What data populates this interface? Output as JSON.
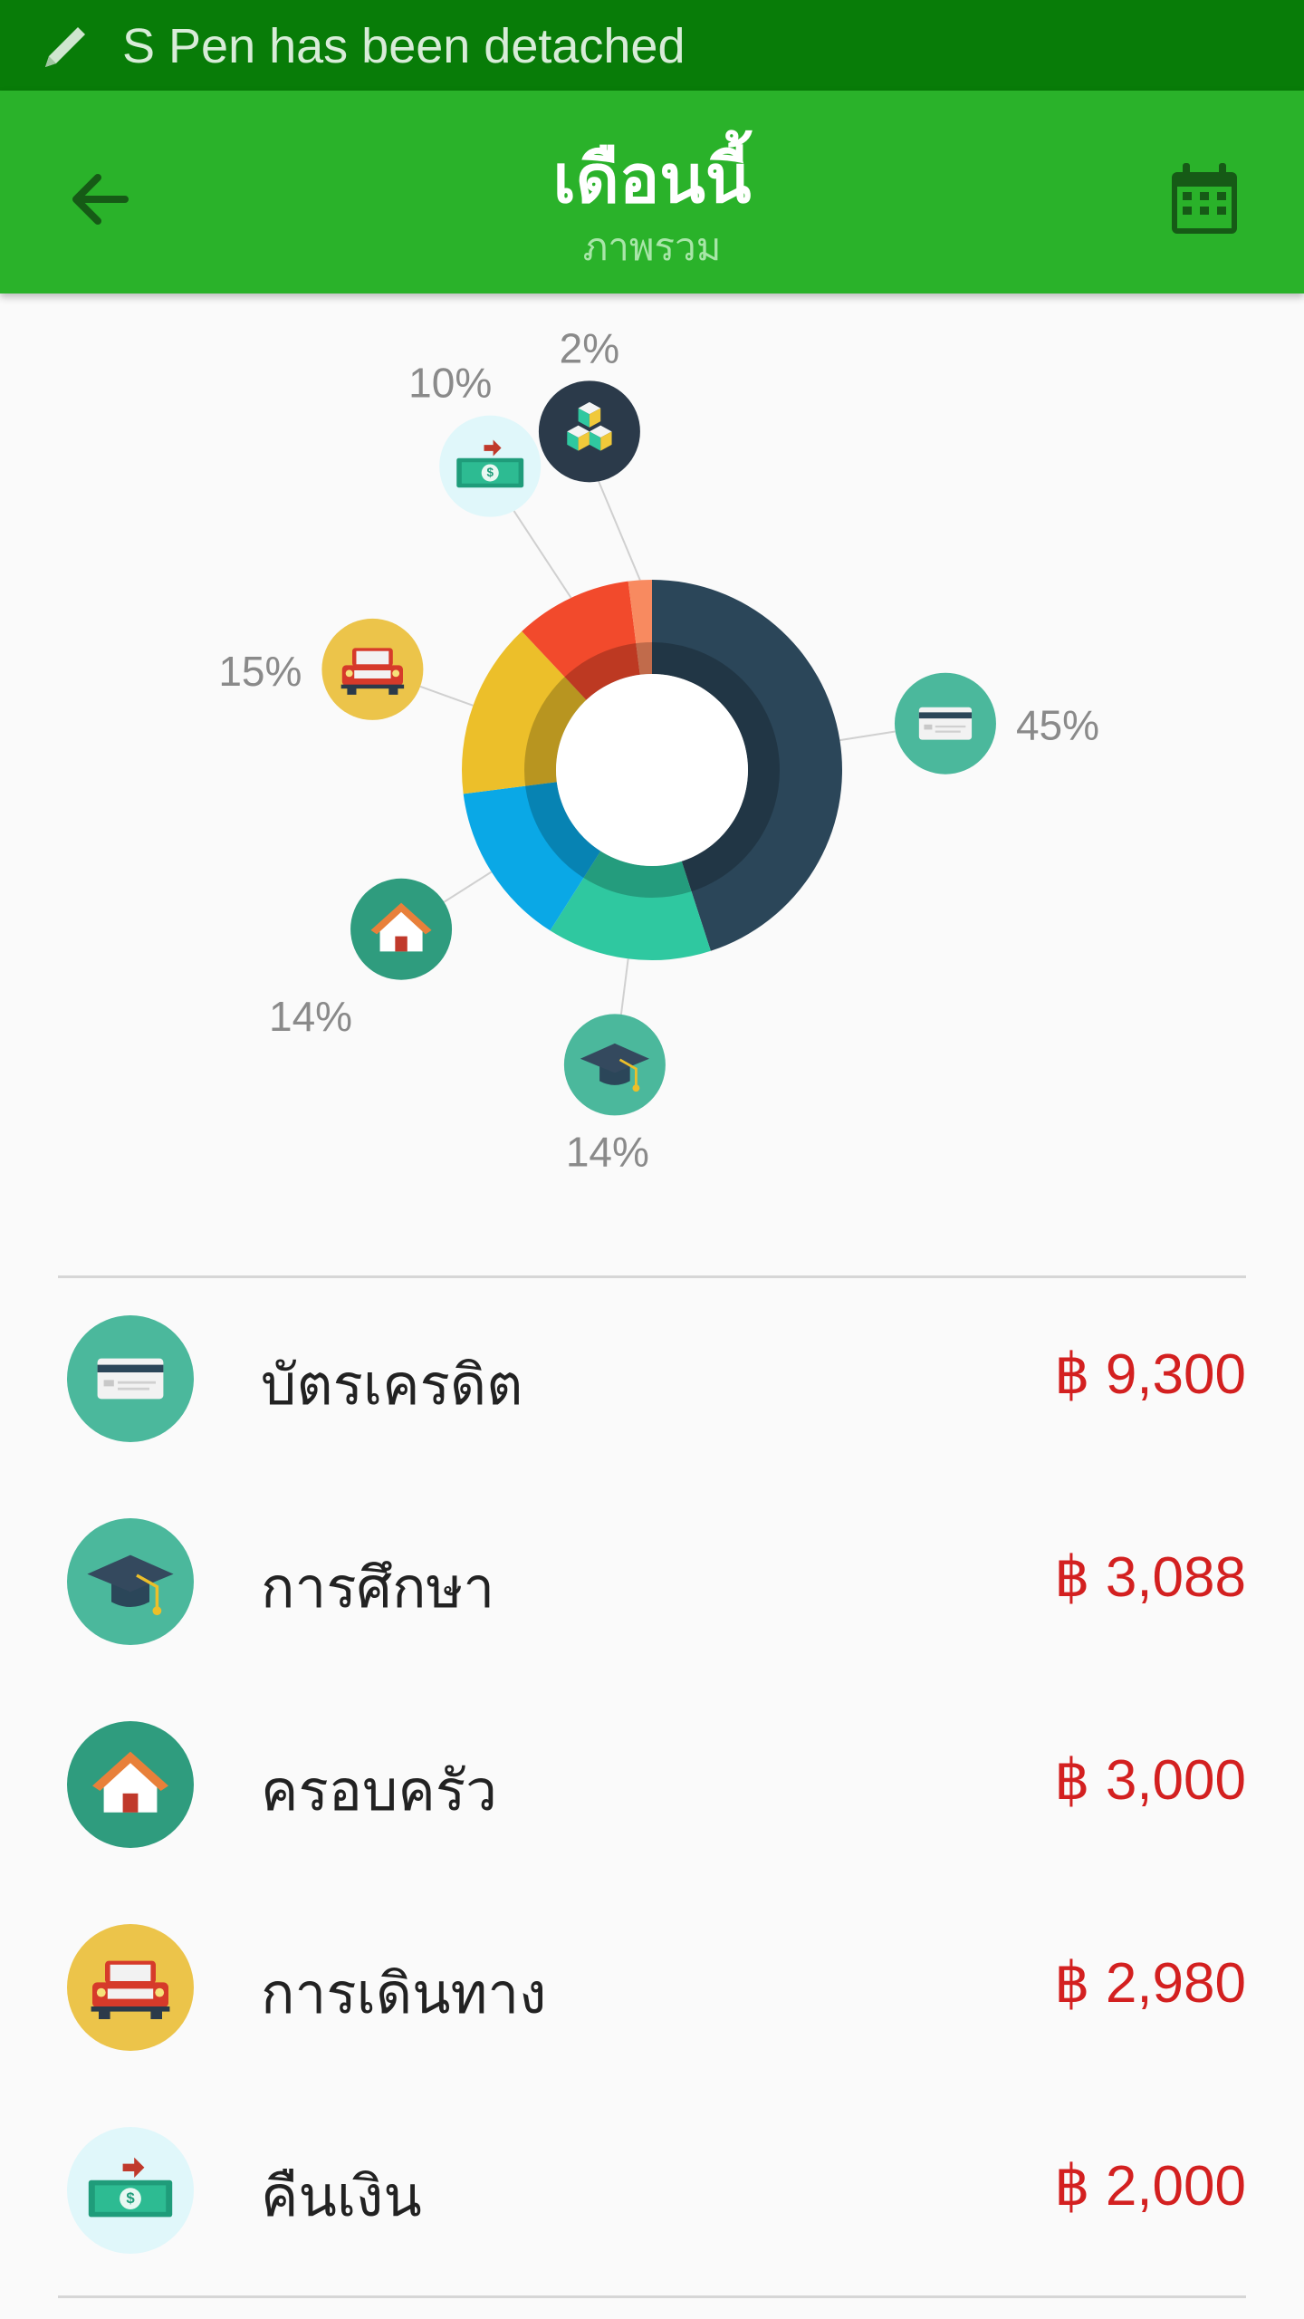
{
  "notification": {
    "text": "S Pen has been detached",
    "icon": "pen-icon"
  },
  "app_bar": {
    "title": "เดือนนี้",
    "subtitle": "ภาพรวม",
    "back_icon": "arrow-back-icon",
    "calendar_icon": "calendar-icon",
    "color": "#2ab22a"
  },
  "chart_data": {
    "type": "pie",
    "variant": "donut",
    "series": [
      {
        "category": "บัตรเครดิต",
        "percent": 45,
        "label": "45%",
        "color": "#2b4659",
        "icon": "credit-card-icon"
      },
      {
        "category": "การศึกษา",
        "percent": 14,
        "label": "14%",
        "color": "#2fc8a0",
        "icon": "graduation-cap-icon"
      },
      {
        "category": "ครอบครัว",
        "percent": 14,
        "label": "14%",
        "color": "#0aa8e6",
        "icon": "house-icon"
      },
      {
        "category": "การเดินทาง",
        "percent": 15,
        "label": "15%",
        "color": "#ecbf2a",
        "icon": "car-icon"
      },
      {
        "category": "คืนเงิน",
        "percent": 10,
        "label": "10%",
        "color": "#f24a2c",
        "icon": "money-icon"
      },
      {
        "category": "",
        "percent": 2,
        "label": "2%",
        "color": "#f88a60",
        "icon": "boxes-icon"
      }
    ]
  },
  "list": [
    {
      "label": "บัตรเครดิต",
      "amount": "฿ 9,300",
      "icon": "credit-card-icon"
    },
    {
      "label": "การศึกษา",
      "amount": "฿ 3,088",
      "icon": "graduation-cap-icon"
    },
    {
      "label": "ครอบครัว",
      "amount": "฿ 3,000",
      "icon": "house-icon"
    },
    {
      "label": "การเดินทาง",
      "amount": "฿ 2,980",
      "icon": "car-icon"
    },
    {
      "label": "คืนเงิน",
      "amount": "฿ 2,000",
      "icon": "money-icon"
    }
  ],
  "colors": {
    "amount": "#d32020",
    "notification_bg": "#087c08"
  }
}
